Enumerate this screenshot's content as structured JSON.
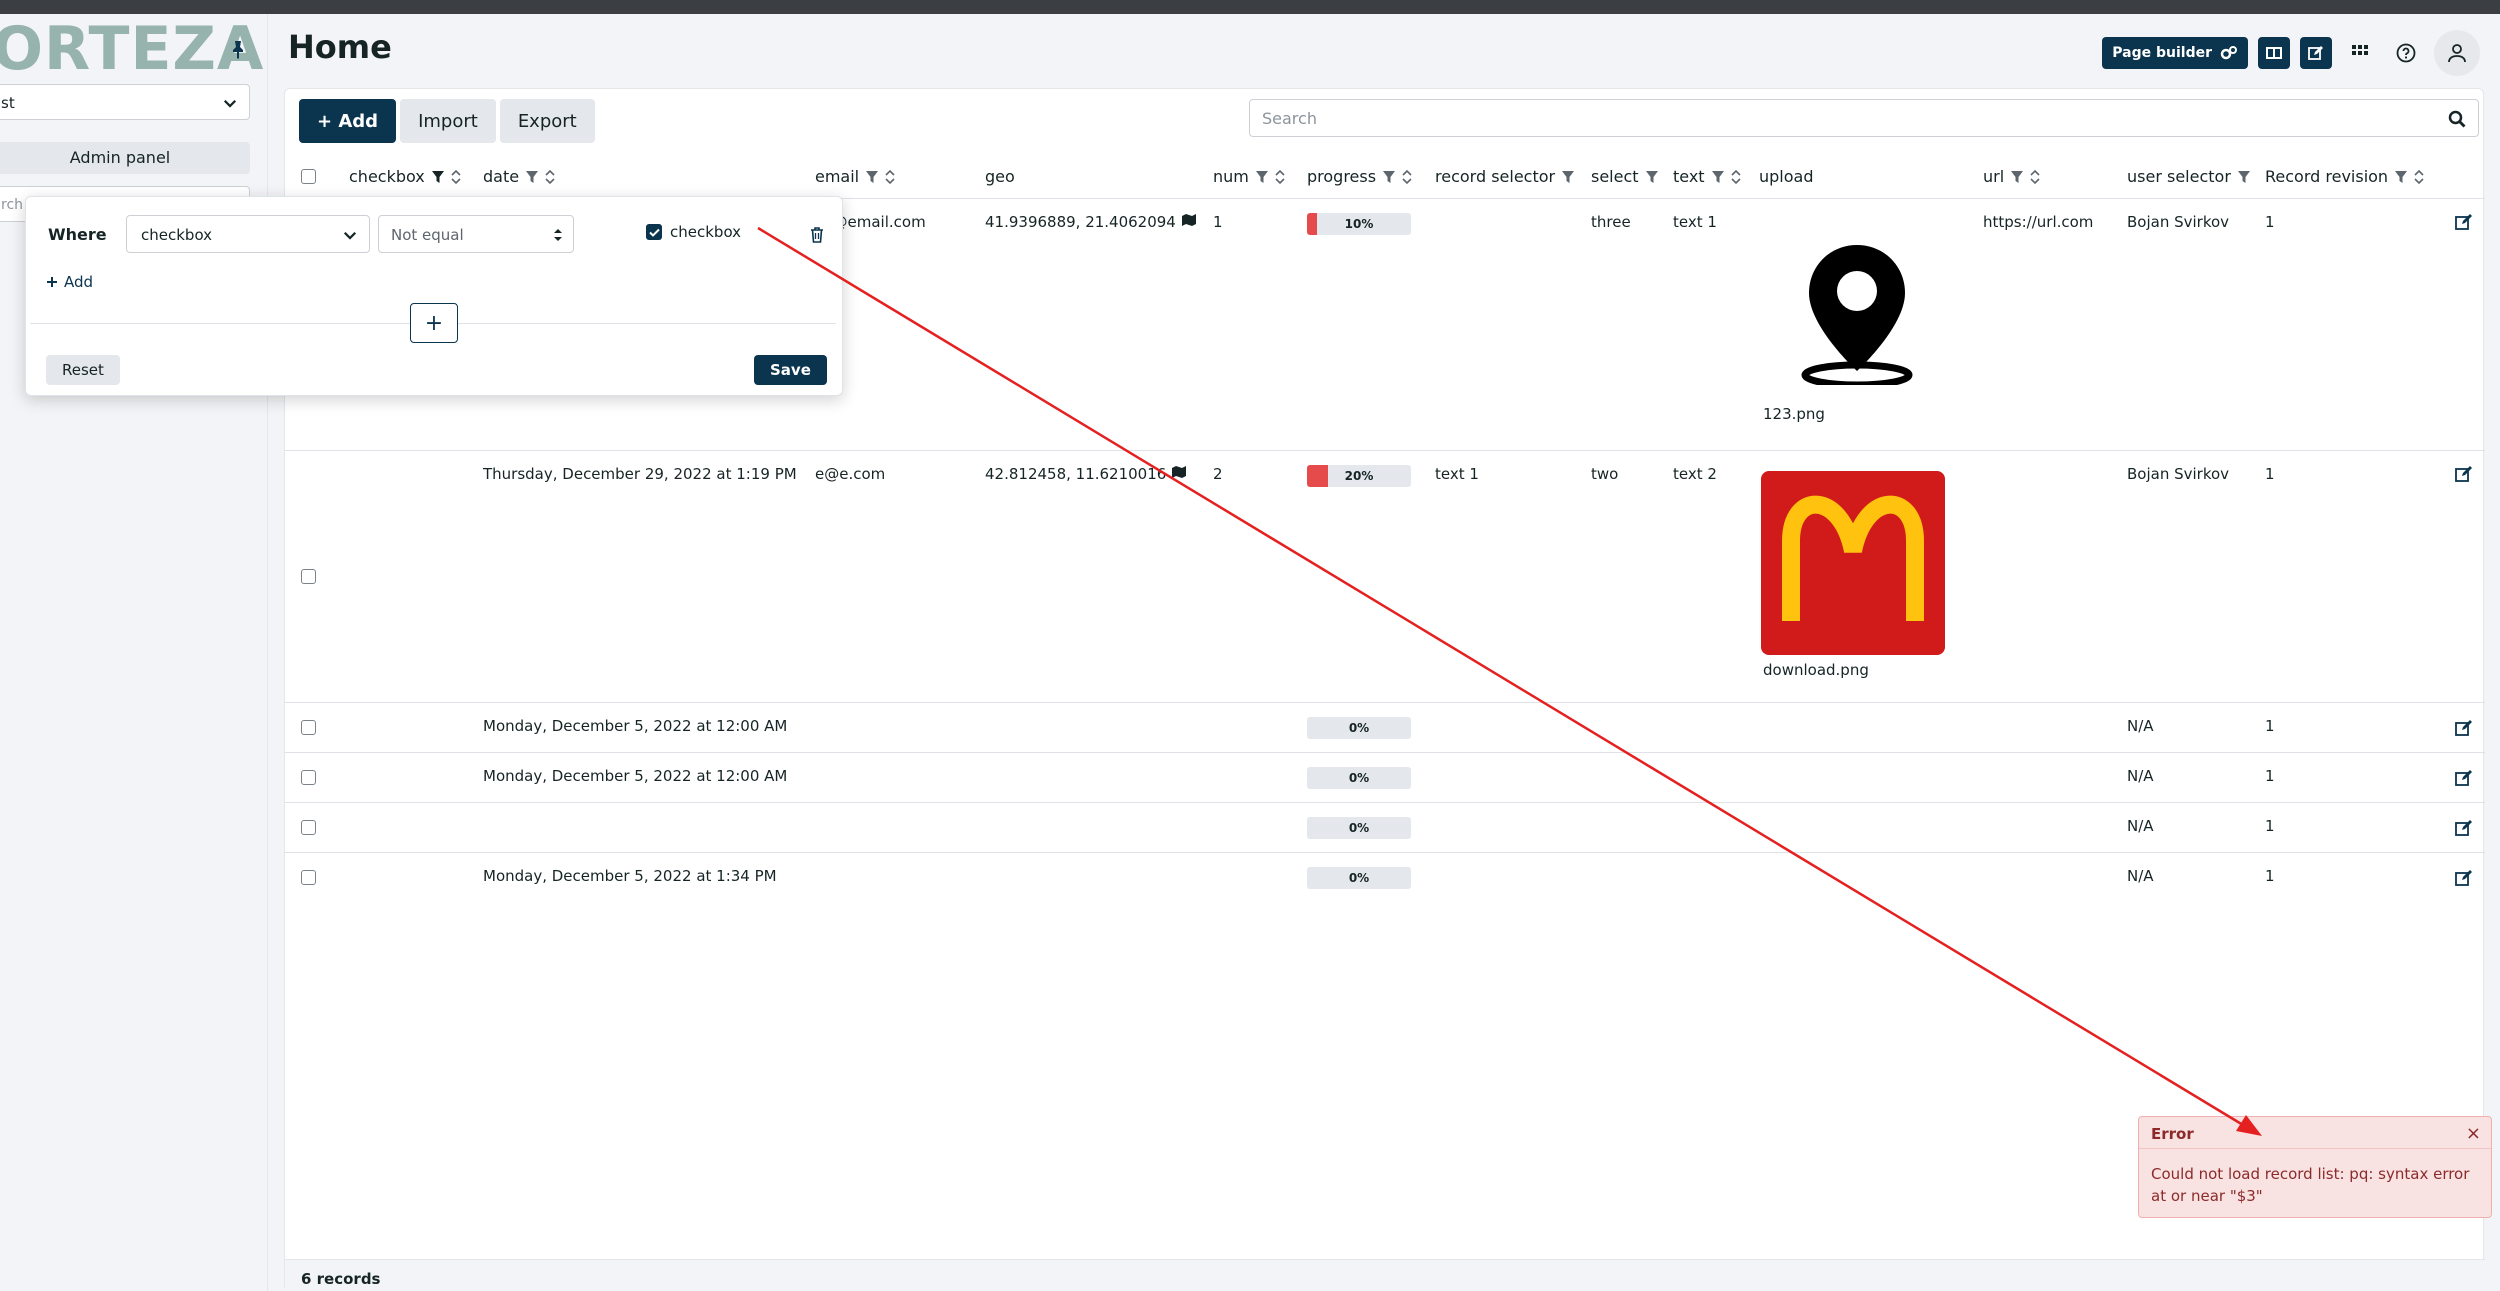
{
  "sidebar": {
    "logo": "ORTEZA",
    "namespace": "st",
    "admin_panel": "Admin panel",
    "search_placeholder": "rch"
  },
  "header": {
    "title": "Home",
    "page_builder": "Page builder"
  },
  "toolbar": {
    "add": "+ Add",
    "import": "Import",
    "export": "Export",
    "search_placeholder": "Search"
  },
  "columns": [
    "checkbox",
    "date",
    "email",
    "geo",
    "num",
    "progress",
    "record selector",
    "select",
    "text",
    "upload",
    "url",
    "user selector",
    "Record revision"
  ],
  "rows": [
    {
      "date": "",
      "email": "ail@email.com",
      "geo": "41.9396889, 21.4062094",
      "num": "1",
      "progress": 10,
      "progress_label": "10%",
      "record_selector": "",
      "select": "three",
      "text": "text 1",
      "upload": "123.png",
      "url": "https://url.com",
      "user": "Bojan Svirkov",
      "revision": "1"
    },
    {
      "date": "Thursday, December 29, 2022 at 1:19 PM",
      "email": "e@e.com",
      "geo": "42.812458, 11.6210016",
      "num": "2",
      "progress": 20,
      "progress_label": "20%",
      "record_selector": "text 1",
      "select": "two",
      "text": "text 2",
      "upload": "download.png",
      "url": "",
      "user": "Bojan Svirkov",
      "revision": "1"
    },
    {
      "date": "Monday, December 5, 2022 at 12:00 AM",
      "progress": 0,
      "progress_label": "0%",
      "user": "N/A",
      "revision": "1"
    },
    {
      "date": "Monday, December 5, 2022 at 12:00 AM",
      "progress": 0,
      "progress_label": "0%",
      "user": "N/A",
      "revision": "1"
    },
    {
      "date": "",
      "progress": 0,
      "progress_label": "0%",
      "user": "N/A",
      "revision": "1"
    },
    {
      "date": "Monday, December 5, 2022 at 1:34 PM",
      "progress": 0,
      "progress_label": "0%",
      "user": "N/A",
      "revision": "1"
    }
  ],
  "footer": {
    "count": "6 records"
  },
  "filter": {
    "where": "Where",
    "field": "checkbox",
    "operator": "Not equal",
    "value_label": "checkbox",
    "add": "Add",
    "plus": "+",
    "reset": "Reset",
    "save": "Save"
  },
  "error": {
    "title": "Error",
    "close": "×",
    "message": "Could not load record list: pq: syntax error at or near \"$3\""
  },
  "colors": {
    "brand": "#0b344e",
    "logo": "#97b3ae",
    "progress_fill": "#e54b4b",
    "error_bg": "#f9e2e2",
    "annotation_arrow": "#e52020"
  }
}
